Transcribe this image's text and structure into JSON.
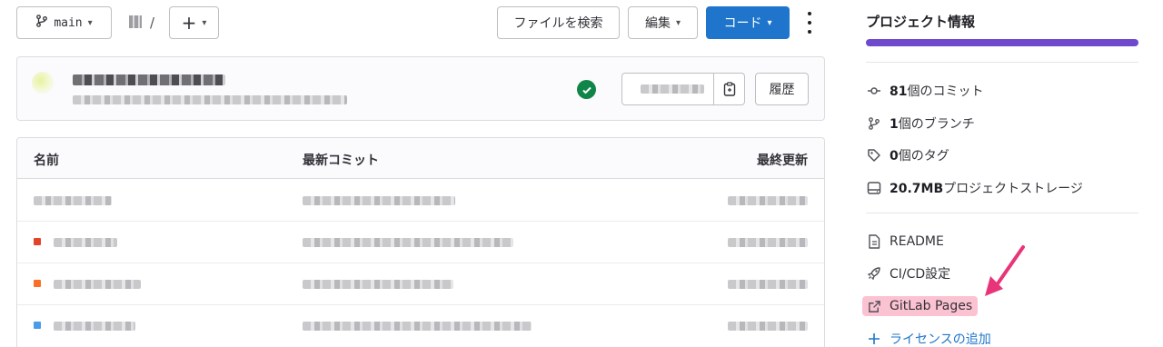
{
  "toolbar": {
    "branch": "main",
    "path_sep": "/",
    "add_symbol": "+",
    "find_file": "ファイルを検索",
    "edit": "編集",
    "code": "コード"
  },
  "commit_card": {
    "history": "履歴",
    "status": "passed"
  },
  "table": {
    "col_name": "名前",
    "col_last_commit": "最新コミット",
    "col_last_update": "最終更新",
    "row_icon_colors": [
      "",
      "#e24329",
      "#fc6d26",
      "#4a9bea"
    ]
  },
  "sidebar": {
    "title": "プロジェクト情報",
    "stats": [
      {
        "icon": "commit-icon",
        "count": "81",
        "label": "個のコミット"
      },
      {
        "icon": "branch-icon",
        "count": "1",
        "label": "個のブランチ"
      },
      {
        "icon": "tag-icon",
        "count": "0",
        "label": "個のタグ"
      },
      {
        "icon": "storage-icon",
        "count": "20.7MB",
        "label": "プロジェクトストレージ"
      }
    ],
    "links": [
      {
        "icon": "file-icon",
        "label": "README"
      },
      {
        "icon": "rocket-icon",
        "label": "CI/CD設定"
      },
      {
        "icon": "external-link-icon",
        "label": "GitLab Pages"
      },
      {
        "icon": "plus-icon",
        "label": "ライセンスの追加"
      }
    ]
  },
  "colors": {
    "accent": "#1f75cb",
    "progress": "#6e49cb",
    "highlight": "#fbc2d2",
    "arrow": "#e8357a",
    "success": "#108548"
  }
}
